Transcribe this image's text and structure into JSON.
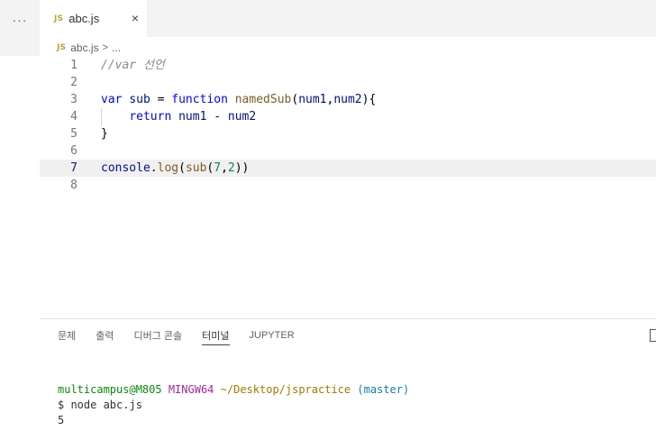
{
  "sidebar": {
    "more_label": "···"
  },
  "tab": {
    "badge": "JS",
    "name": "abc.js",
    "close": "×"
  },
  "breadcrumb": {
    "badge": "JS",
    "file": "abc.js",
    "separator": ">",
    "more": "..."
  },
  "editor": {
    "active_line": 7,
    "lines": [
      {
        "n": "1",
        "tokens": [
          {
            "t": "//var 선언",
            "c": "cm"
          }
        ]
      },
      {
        "n": "2",
        "tokens": []
      },
      {
        "n": "3",
        "tokens": [
          {
            "t": "var",
            "c": "kw"
          },
          {
            "t": " ",
            "c": "op"
          },
          {
            "t": "sub",
            "c": "var"
          },
          {
            "t": " = ",
            "c": "op"
          },
          {
            "t": "function",
            "c": "kw"
          },
          {
            "t": " ",
            "c": "op"
          },
          {
            "t": "namedSub",
            "c": "fn"
          },
          {
            "t": "(",
            "c": "op"
          },
          {
            "t": "num1",
            "c": "var"
          },
          {
            "t": ",",
            "c": "op"
          },
          {
            "t": "num2",
            "c": "var"
          },
          {
            "t": "){",
            "c": "op"
          }
        ]
      },
      {
        "n": "4",
        "tokens": [
          {
            "t": "    ",
            "c": "op"
          },
          {
            "t": "return",
            "c": "kw"
          },
          {
            "t": " ",
            "c": "op"
          },
          {
            "t": "num1",
            "c": "var"
          },
          {
            "t": " - ",
            "c": "op"
          },
          {
            "t": "num2",
            "c": "var"
          }
        ]
      },
      {
        "n": "5",
        "tokens": [
          {
            "t": "}",
            "c": "op"
          }
        ]
      },
      {
        "n": "6",
        "tokens": []
      },
      {
        "n": "7",
        "tokens": [
          {
            "t": "console",
            "c": "var"
          },
          {
            "t": ".",
            "c": "op"
          },
          {
            "t": "log",
            "c": "fn"
          },
          {
            "t": "(",
            "c": "op"
          },
          {
            "t": "sub",
            "c": "fn"
          },
          {
            "t": "(",
            "c": "op"
          },
          {
            "t": "7",
            "c": "num"
          },
          {
            "t": ",",
            "c": "op"
          },
          {
            "t": "2",
            "c": "num"
          },
          {
            "t": "))",
            "c": "op"
          }
        ]
      },
      {
        "n": "8",
        "tokens": []
      }
    ]
  },
  "panel": {
    "tabs": [
      {
        "label": "문제",
        "active": false
      },
      {
        "label": "출력",
        "active": false
      },
      {
        "label": "디버그 콘솔",
        "active": false
      },
      {
        "label": "터미널",
        "active": true
      },
      {
        "label": "JUPYTER",
        "active": false
      }
    ]
  },
  "terminal": {
    "user": "multicampus@M805",
    "system": "MINGW64",
    "path": "~/Desktop/jspractice",
    "branch": "(master)",
    "command": "$ node abc.js",
    "output": "5"
  },
  "colors": {
    "accent_js": "#b7a43b",
    "keyword": "#0000ff",
    "function": "#795e26",
    "number": "#098658"
  }
}
